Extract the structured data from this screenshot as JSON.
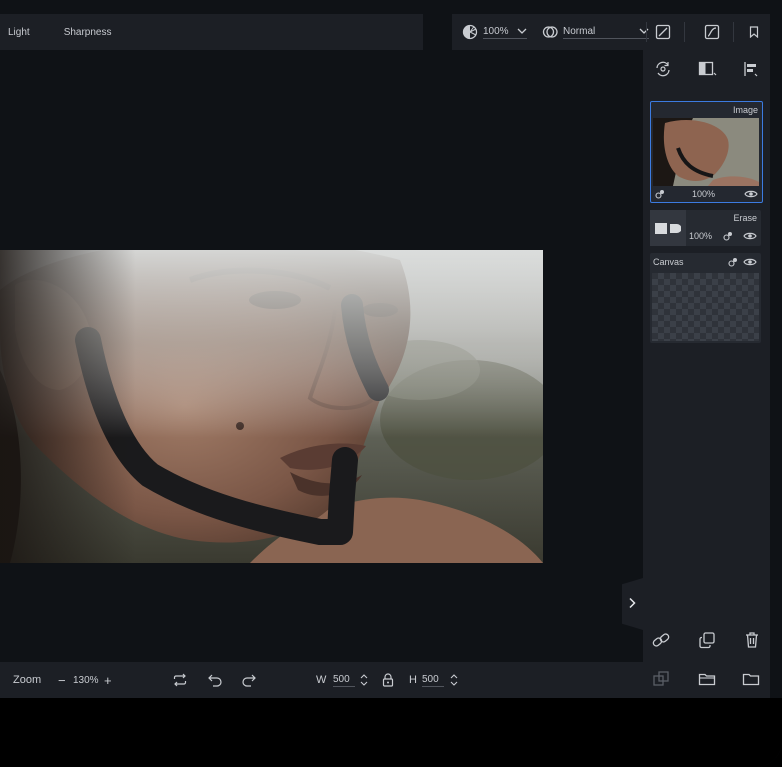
{
  "toolbar": {
    "tabs": [
      {
        "label": "Light"
      },
      {
        "label": "Sharpness"
      }
    ],
    "opacity_value": "100%",
    "blend_mode": "Normal",
    "icons": [
      "opacity-icon",
      "blend-mode-icon",
      "curve-tool-icon",
      "curve-tool-alt-icon",
      "bookmark-icon"
    ]
  },
  "panel": {
    "top_icons": [
      "sync-icon",
      "compare-icon",
      "align-icon"
    ],
    "layers": [
      {
        "name": "Image",
        "opacity": "100%",
        "selected": true
      },
      {
        "name": "Erase",
        "opacity": "100%",
        "selected": false
      },
      {
        "name": "Canvas",
        "selected": false
      }
    ],
    "bottom_icons": [
      "link-icon",
      "duplicate-icon",
      "delete-icon",
      "merge-icon",
      "open-folder-icon",
      "folder-icon"
    ]
  },
  "bottombar": {
    "zoom_label": "Zoom",
    "zoom_minus": "−",
    "zoom_value": "130%",
    "zoom_plus": "+",
    "width_label": "W",
    "width_value": "500",
    "height_label": "H",
    "height_value": "500"
  },
  "colors": {
    "background": "#0f1216",
    "panel": "#1c1f25",
    "accent": "#3c7be0"
  }
}
